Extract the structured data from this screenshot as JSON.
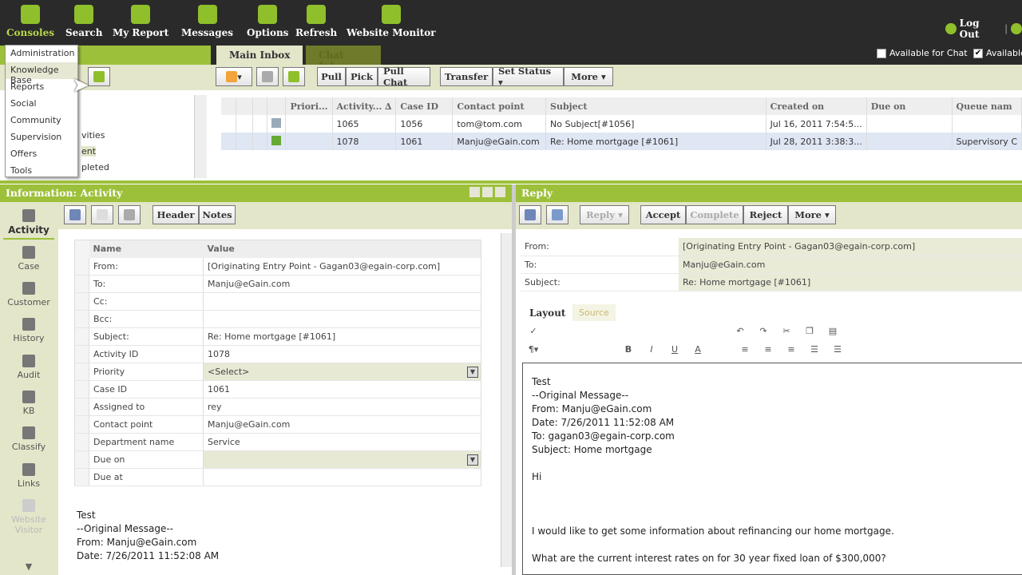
{
  "nav": [
    {
      "label": "Consoles",
      "icon": "home-icon"
    },
    {
      "label": "Search",
      "icon": "search-icon"
    },
    {
      "label": "My Report",
      "icon": "report-icon"
    },
    {
      "label": "Messages",
      "icon": "messages-icon"
    },
    {
      "label": "Options",
      "icon": "tools-icon"
    },
    {
      "label": "Refresh",
      "icon": "refresh-icon"
    },
    {
      "label": "Website Monitor",
      "icon": "monitor-icon"
    }
  ],
  "header": {
    "logout": "Log Out",
    "available_chat": "Available for Chat",
    "available": "Available",
    "available_chat_checked": false,
    "available_checked": true
  },
  "consoles_menu": [
    "Administration",
    "Knowledge Base",
    "Reports",
    "Social",
    "Community",
    "Supervision",
    "Offers",
    "Tools"
  ],
  "tabs": [
    "Main Inbox",
    "Chat Inbox"
  ],
  "folder_fragments": [
    "vities",
    "ent",
    "pleted"
  ],
  "inbox_toolbar": {
    "pull": "Pull",
    "pick": "Pick",
    "pull_chat": "Pull Chat",
    "transfer": "Transfer",
    "set_status": "Set Status ▾",
    "more": "More ▾"
  },
  "grid": {
    "columns": [
      "",
      "",
      "",
      "",
      "Priori...",
      "Activity... ∆",
      "Case ID",
      "Contact point",
      "Subject",
      "Created on",
      "Due on",
      "Queue nam"
    ],
    "rows": [
      {
        "activity": "1065",
        "case": "1056",
        "contact": "tom@tom.com",
        "subject": "No Subject[#1056]",
        "created": "Jul 16, 2011 7:54:5...",
        "due": "",
        "queue": ""
      },
      {
        "activity": "1078",
        "case": "1061",
        "contact": "Manju@eGain.com",
        "subject": "Re: Home mortgage [#1061]",
        "created": "Jul 28, 2011 3:38:3...",
        "due": "",
        "queue": "Supervisory C"
      }
    ]
  },
  "info": {
    "title": "Information: Activity",
    "header_btn": "Header",
    "notes_btn": "Notes",
    "side": [
      "Activity",
      "Case",
      "Customer",
      "History",
      "Audit",
      "KB",
      "Classify",
      "Links",
      "Website Visitor"
    ],
    "col_name": "Name",
    "col_value": "Value",
    "props": [
      [
        "From:",
        "[Originating Entry Point - Gagan03@egain-corp.com]"
      ],
      [
        "To:",
        "Manju@eGain.com"
      ],
      [
        "Cc:",
        ""
      ],
      [
        "Bcc:",
        ""
      ],
      [
        "Subject:",
        "Re: Home mortgage [#1061]"
      ],
      [
        "Activity ID",
        "1078"
      ],
      [
        "Priority",
        "<Select>"
      ],
      [
        "Case ID",
        "1061"
      ],
      [
        "Assigned to",
        "rey"
      ],
      [
        "Contact point",
        "Manju@eGain.com"
      ],
      [
        "Department name",
        "Service"
      ],
      [
        "Due on",
        ""
      ],
      [
        "Due at",
        ""
      ]
    ],
    "message": [
      "Test",
      "--Original Message--",
      "From: Manju@eGain.com",
      "Date: 7/26/2011 11:52:08 AM"
    ]
  },
  "reply": {
    "title": "Reply",
    "reply_btn": "Reply ▾",
    "accept": "Accept",
    "complete": "Complete",
    "reject": "Reject",
    "more": "More ▾",
    "from_label": "From:",
    "from": "[Originating Entry Point - Gagan03@egain-corp.com]",
    "to_label": "To:",
    "to": "Manju@eGain.com",
    "subject_label": "Subject:",
    "subject": "Re: Home mortgage [#1061]",
    "tab_layout": "Layout",
    "tab_source": "Source",
    "body": [
      "Test",
      "--Original Message--",
      "From: Manju@eGain.com",
      "Date: 7/26/2011 11:52:08 AM",
      "To: gagan03@egain-corp.com",
      "Subject: Home mortgage",
      "",
      "Hi",
      "",
      "",
      "",
      "I would like to get some information about refinancing our home mortgage.",
      "",
      "What are the current interest rates on for  30 year fixed loan of $300,000?"
    ]
  },
  "colors": {
    "accent": "#9dc03a",
    "toolbar": "#e3e6c9",
    "topbar": "#2a2a2a"
  }
}
